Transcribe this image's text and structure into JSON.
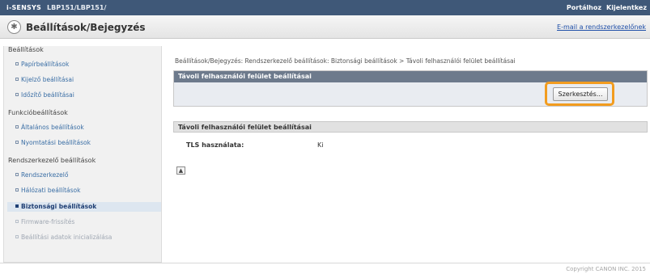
{
  "header": {
    "brand": "i-SENSYS",
    "model": "LBP151/LBP151/",
    "portal_link": "Portálhoz",
    "logout_link": "Kijelentkez"
  },
  "title_bar": {
    "title": "Beállítások/Bejegyzés",
    "email_link": "E-mail a rendszerkezelőnek"
  },
  "sidebar": {
    "sections": [
      {
        "label": "Beállítások",
        "items": [
          "Papírbeállítások",
          "Kijelző beállításai",
          "Időzítő beállításai"
        ]
      },
      {
        "label": "Funkcióbeállítások",
        "items": [
          "Általános beállítások",
          "Nyomtatási beállítások"
        ]
      },
      {
        "label": "Rendszerkezelő beállítások",
        "items": [
          "Rendszerkezelő",
          "Hálózati beállítások",
          "Biztonsági beállítások",
          "Firmware-frissítés",
          "Beállítási adatok inicializálása"
        ]
      }
    ],
    "active_item": "Biztonsági beállítások"
  },
  "breadcrumb": "Beállítások/Bejegyzés: Rendszerkezelő beállítások: Biztonsági beállítások > Távoli felhasználói felület beállításai",
  "panel1": {
    "header": "Távoli felhasználói felület beállításai",
    "edit_button": "Szerkesztés..."
  },
  "panel2": {
    "header": "Távoli felhasználói felület beállításai",
    "rows": [
      {
        "label": "TLS használata:",
        "value": "Ki"
      }
    ]
  },
  "page_top_icon": "page-top-icon",
  "copyright": "Copyright CANON INC. 2015",
  "colors": {
    "topbar": "#3f5878",
    "panel_header": "#6d7a8c",
    "highlight": "#f29c1f",
    "link": "#3a6ea5"
  }
}
